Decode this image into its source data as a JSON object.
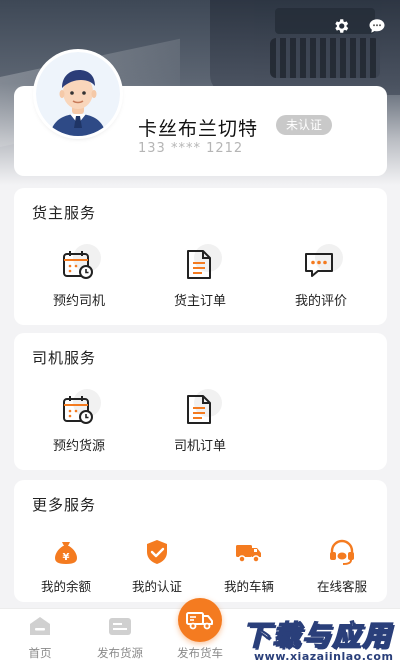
{
  "header": {
    "settings_icon": "gear-icon",
    "message_icon": "chat-bubble-icon"
  },
  "profile": {
    "name": "卡丝布兰切特",
    "cert_status": "未认证",
    "phone": "133 **** 1212"
  },
  "cargo_owner_services": {
    "title": "货主服务",
    "items": [
      {
        "label": "预约司机",
        "icon": "calendar-clock-icon"
      },
      {
        "label": "货主订单",
        "icon": "document-icon"
      },
      {
        "label": "我的评价",
        "icon": "comment-icon"
      }
    ]
  },
  "driver_services": {
    "title": "司机服务",
    "items": [
      {
        "label": "预约货源",
        "icon": "calendar-clock-icon"
      },
      {
        "label": "司机订单",
        "icon": "document-icon"
      }
    ]
  },
  "more_services": {
    "title": "更多服务",
    "items": [
      {
        "label": "我的余额",
        "icon": "money-bag-icon"
      },
      {
        "label": "我的认证",
        "icon": "shield-check-icon"
      },
      {
        "label": "我的车辆",
        "icon": "truck-icon"
      },
      {
        "label": "在线客服",
        "icon": "headset-icon"
      }
    ]
  },
  "bottom_nav": {
    "items": [
      {
        "label": "首页",
        "icon": "home-icon"
      },
      {
        "label": "发布货源",
        "icon": "cargo-card-icon"
      },
      {
        "label": "发布货车",
        "icon": "truck-icon"
      }
    ]
  },
  "watermark": {
    "title": "下载与应用",
    "url": "www.xiazaiinlao.com"
  },
  "colors": {
    "accent": "#f47b20",
    "text_primary": "#222222",
    "text_muted": "#b5b5b5",
    "badge_bg": "#c9c9c9"
  }
}
